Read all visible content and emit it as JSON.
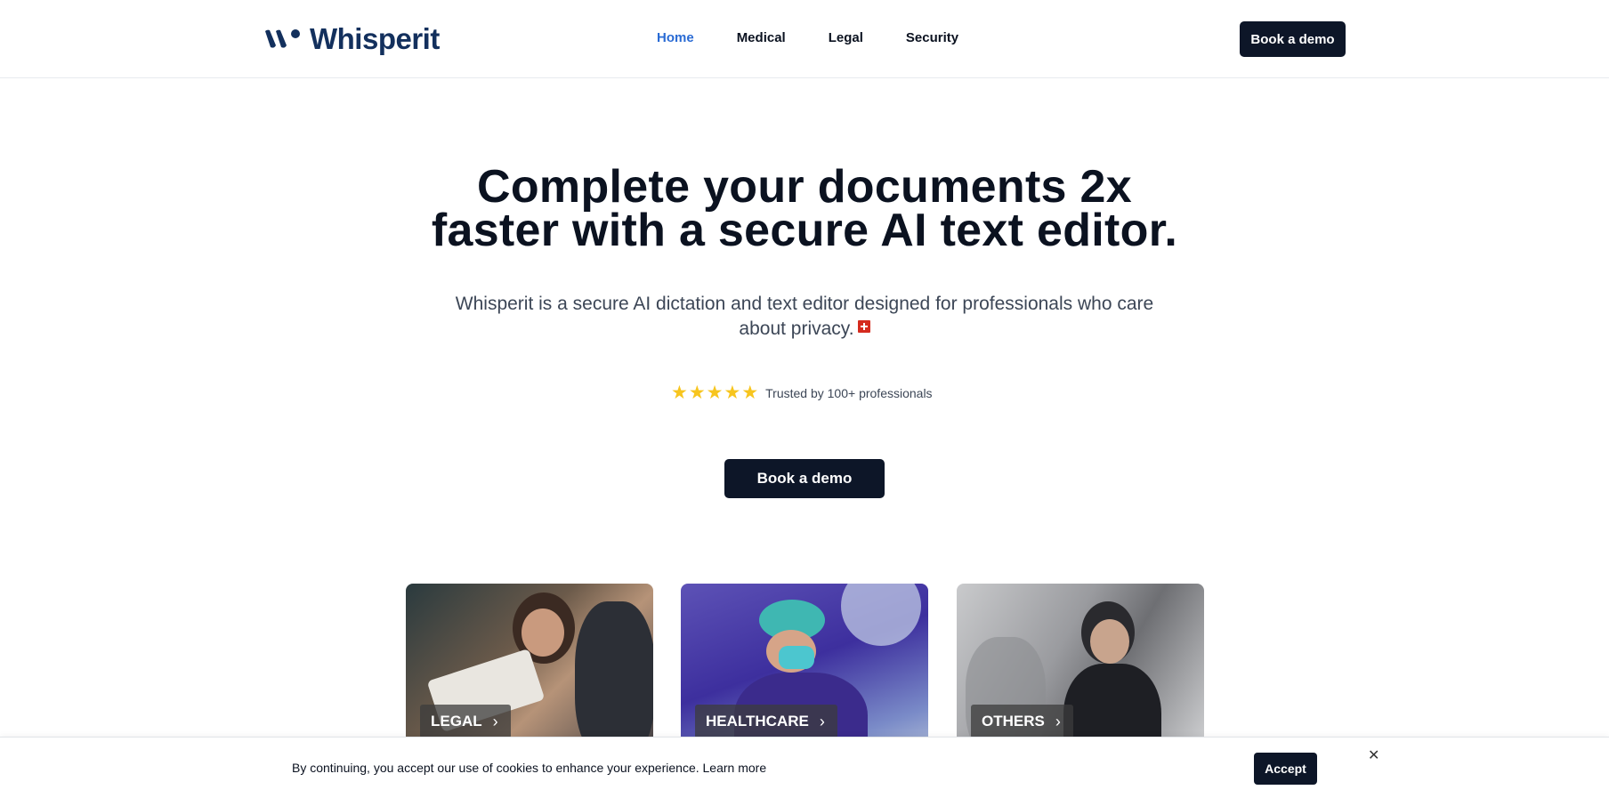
{
  "brand": {
    "name": "Whisperit",
    "color": "#13305d"
  },
  "nav": {
    "items": [
      {
        "label": "Home",
        "active": true
      },
      {
        "label": "Medical",
        "active": false
      },
      {
        "label": "Legal",
        "active": false
      },
      {
        "label": "Security",
        "active": false
      }
    ]
  },
  "header": {
    "cta_label": "Book a demo"
  },
  "hero": {
    "title_line1": "Complete your documents 2x",
    "title_line2": "faster with a secure AI text editor.",
    "subtitle_line1": "Whisperit is a secure AI dictation and text editor designed for professionals who care",
    "subtitle_line2": "about privacy.",
    "flag_icon": "swiss-flag-icon",
    "rating_stars": 5,
    "rating_text": "Trusted by 100+ professionals",
    "cta_label": "Book a demo"
  },
  "cards": [
    {
      "label": "LEGAL",
      "icon": "chevron-right-icon"
    },
    {
      "label": "HEALTHCARE",
      "icon": "chevron-right-icon"
    },
    {
      "label": "OTHERS",
      "icon": "chevron-right-icon"
    }
  ],
  "cookie": {
    "text": "By continuing, you accept our use of cookies to enhance your experience.",
    "learn_more": "Learn more",
    "accept_label": "Accept",
    "close_icon": "close-icon"
  },
  "colors": {
    "accent": "#2a6bd4",
    "button_dark": "#0d1628",
    "star": "#f7c51e"
  }
}
